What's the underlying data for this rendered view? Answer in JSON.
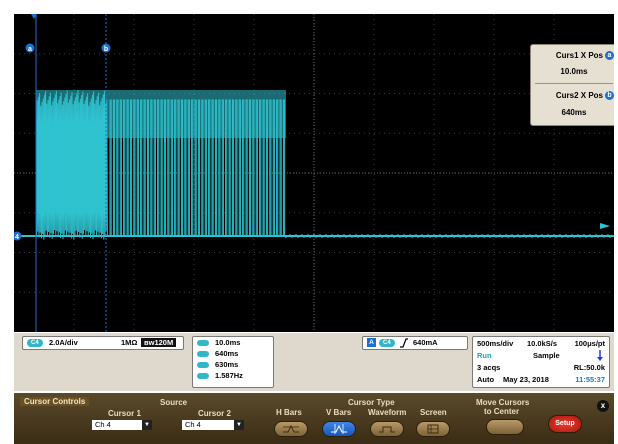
{
  "cursor_readout": {
    "cursor1_label": "Curs1 X Pos",
    "cursor1_badge": "a",
    "cursor1_value": "10.0ms",
    "cursor2_label": "Curs2 X Pos",
    "cursor2_badge": "b",
    "cursor2_value": "640ms"
  },
  "plot_markers": {
    "cursor_a_tag": "a",
    "cursor_b_tag": "b",
    "channel_ground_tag": "4"
  },
  "channel_panel": {
    "channel_tag": "C4",
    "scale": "2.0A/div",
    "impedance": "1MΩ",
    "bandwidth": "120M"
  },
  "measurements": {
    "tags": [
      "a",
      "b",
      "Δ",
      "1/Δ"
    ],
    "values": [
      "10.0ms",
      "640ms",
      "630ms",
      "1.587Hz"
    ]
  },
  "trigger_panel": {
    "mode_tag": "A",
    "channel_tag": "C4",
    "level": "640mA"
  },
  "acquisition": {
    "timebase": "500ms/div",
    "sample_rate": "10.0kS/s",
    "resolution": "100μs/pt",
    "state": "Run",
    "mode": "Sample",
    "acqs": "3 acqs",
    "record_length": "RL:50.0k",
    "trigger_mode": "Auto",
    "date": "May 23, 2018",
    "time": "11:55:37"
  },
  "controls": {
    "title": "Cursor Controls",
    "source_label": "Source",
    "cursor1_label": "Cursor 1",
    "cursor1_value": "Ch 4",
    "cursor2_label": "Cursor 2",
    "cursor2_value": "Ch 4",
    "cursor_type_label": "Cursor Type",
    "type_options": [
      "H Bars",
      "V Bars",
      "Waveform",
      "Screen"
    ],
    "active_type": "V Bars",
    "move_label_1": "Move Cursors",
    "move_label_2": "to Center",
    "setup_label": "Setup",
    "close_label": "x"
  },
  "colors": {
    "trace": "#2fc2cf",
    "cursor_line": "#1f6fd1",
    "panel_bg": "#ded9cc",
    "control_bg": "#4a3a20",
    "run_text": "#1aa0b8"
  }
}
